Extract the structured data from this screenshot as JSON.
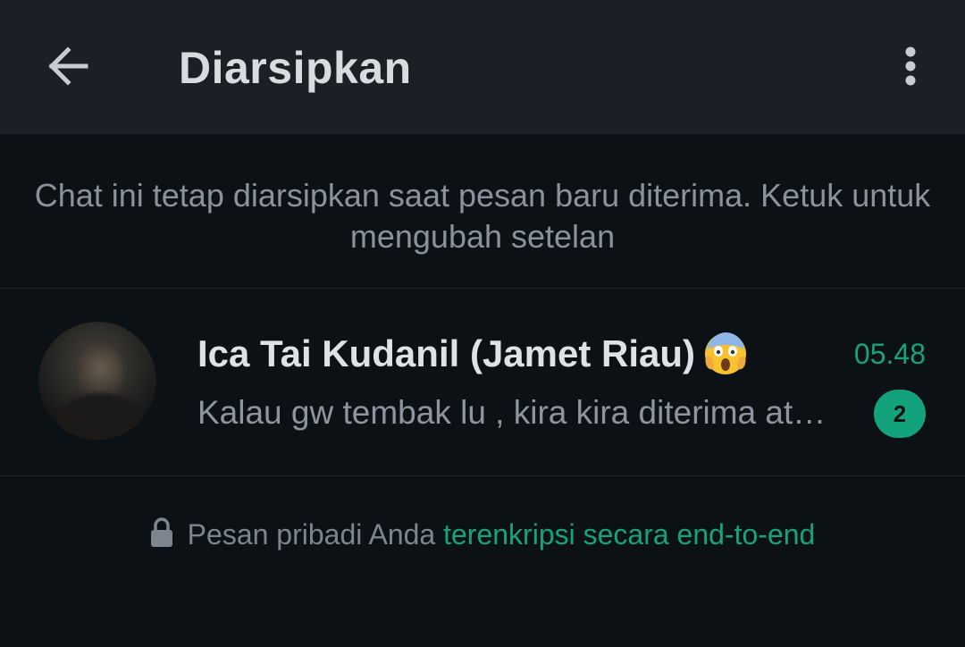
{
  "appbar": {
    "title": "Diarsipkan",
    "back_icon": "arrow-back-icon",
    "menu_icon": "more-vertical-icon"
  },
  "notice": {
    "text": "Chat ini tetap diarsipkan saat pesan baru diterima. Ketuk untuk mengubah setelan"
  },
  "chats": [
    {
      "name": "Ica Tai Kudanil (Jamet Riau)",
      "emoji": "face-screaming-in-fear-emoji",
      "time": "05.48",
      "preview": "Kalau gw tembak lu , kira kira diterima atau tidak",
      "unread_count": "2"
    }
  ],
  "footer": {
    "text": "Pesan pribadi Anda",
    "link": "terenkripsi secara end-to-end",
    "icon": "lock-icon"
  },
  "colors": {
    "accent": "#16a37a",
    "appbar_bg": "#1a2026",
    "background": "#0c1116"
  }
}
